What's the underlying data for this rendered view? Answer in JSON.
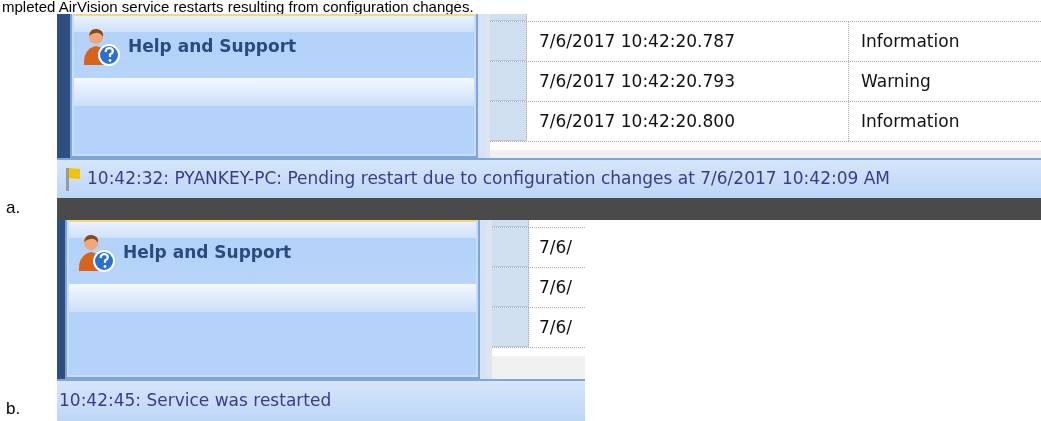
{
  "caption": "mpleted AirVision service restarts resulting from configuration changes.",
  "screenshots": [
    {
      "label": "a.",
      "sidebar": {
        "items": [
          {
            "label": "Help and Support",
            "selected": true
          }
        ]
      },
      "grid": {
        "rows": [
          {
            "date": "7/6/2017 10:42:20.787",
            "level": "Information"
          },
          {
            "date": "7/6/2017 10:42:20.793",
            "level": "Warning"
          },
          {
            "date": "7/6/2017 10:42:20.800",
            "level": "Information"
          }
        ]
      },
      "status_bar": {
        "kind": "flagged",
        "text": "10:42:32: PYANKEY-PC: Pending restart due to configuration changes at 7/6/2017 10:42:09 AM"
      }
    },
    {
      "label": "b.",
      "sidebar": {
        "items": [
          {
            "label": "Help and Support",
            "selected": true
          }
        ]
      },
      "grid": {
        "rows": [
          {
            "date": "7/6/"
          },
          {
            "date": "7/6/"
          },
          {
            "date": "7/6/"
          }
        ]
      },
      "status_bar": {
        "kind": "plain",
        "text": "10:42:45: Service was restarted"
      }
    }
  ]
}
